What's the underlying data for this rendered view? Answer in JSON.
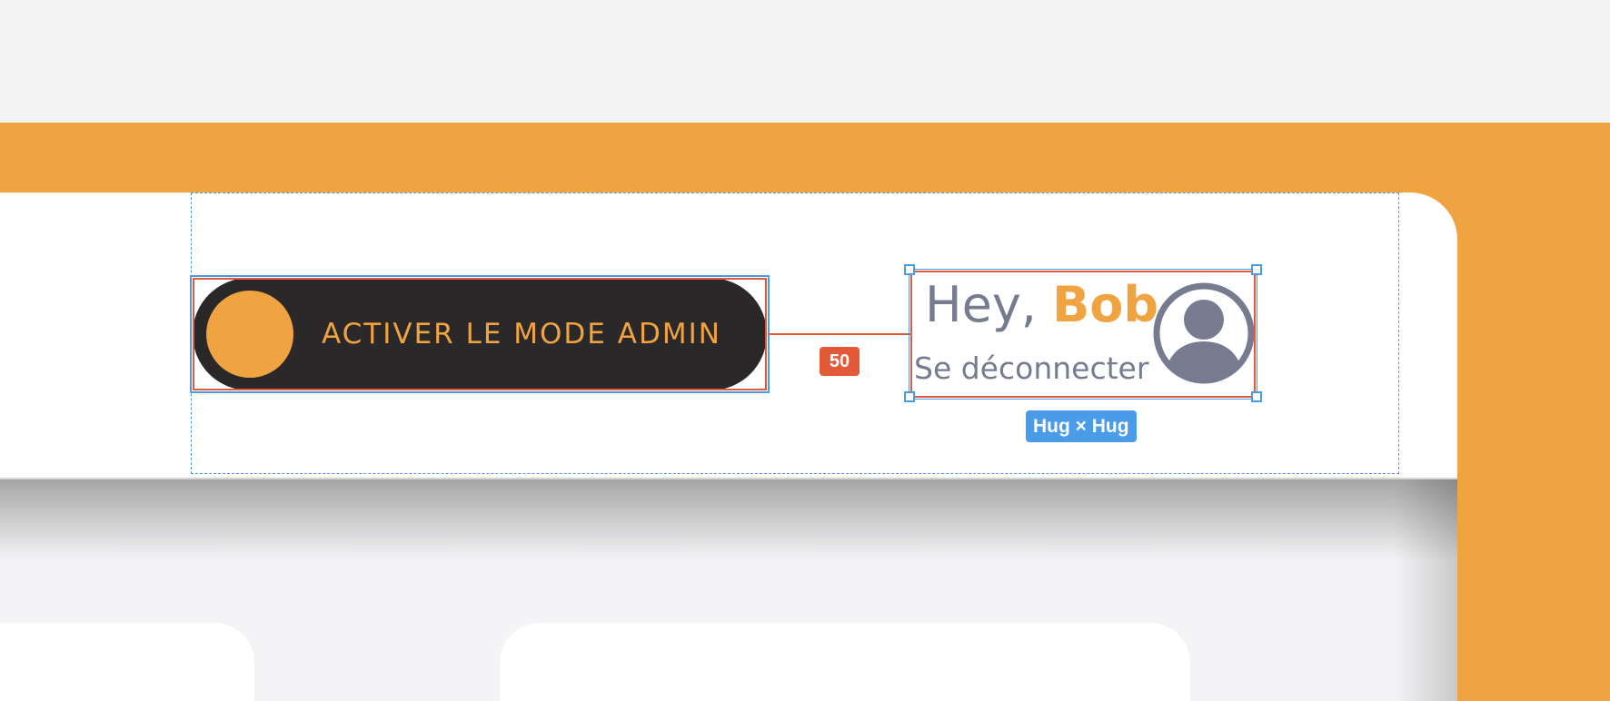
{
  "header": {
    "admin_toggle": {
      "label": "ACTIVER LE MODE ADMIN",
      "enabled": false
    },
    "user": {
      "greeting_prefix": "Hey, ",
      "name": "Bob",
      "logout_label": "Se déconnecter",
      "avatar_icon": "user-avatar-icon"
    }
  },
  "design_overlay": {
    "gap_value": "50",
    "sizing_label": "Hug × Hug"
  },
  "colors": {
    "accent": "#f0a341",
    "toggle_bg": "#2b2829",
    "text_muted": "#767b8f",
    "selection_blue": "#4a9be8",
    "spacing_red": "#e35a3a"
  }
}
